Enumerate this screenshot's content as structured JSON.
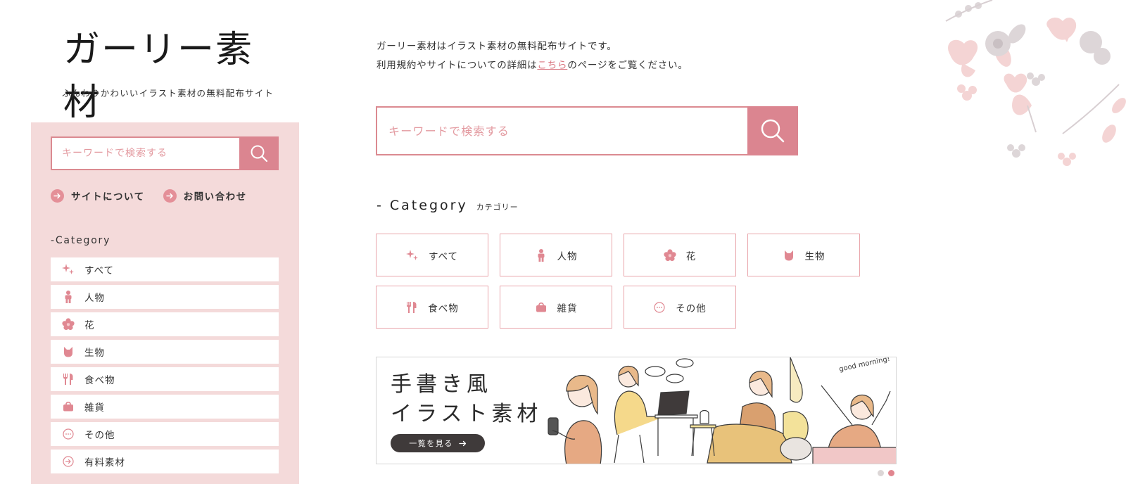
{
  "site": {
    "title": "ガーリー素材",
    "tagline": "ふんわりかわいいイラスト素材の無料配布サイト"
  },
  "intro": {
    "line1": "ガーリー素材はイラスト素材の無料配布サイトです。",
    "line2_before": "利用規約やサイトについての詳細は",
    "line2_link": "こちら",
    "line2_after": "のページをご覧ください。"
  },
  "search": {
    "placeholder": "キーワードで検索する"
  },
  "sidebar": {
    "links": [
      {
        "label": "サイトについて"
      },
      {
        "label": "お問い合わせ"
      }
    ],
    "category_heading": "-Category",
    "items": [
      {
        "label": "すべて",
        "icon": "sparkle-icon"
      },
      {
        "label": "人物",
        "icon": "person-icon"
      },
      {
        "label": "花",
        "icon": "flower-icon"
      },
      {
        "label": "生物",
        "icon": "cat-icon"
      },
      {
        "label": "食べ物",
        "icon": "fork-knife-icon"
      },
      {
        "label": "雑貨",
        "icon": "bag-icon"
      },
      {
        "label": "その他",
        "icon": "more-icon"
      },
      {
        "label": "有料素材",
        "icon": "arrow-circle-icon"
      }
    ]
  },
  "category": {
    "heading_en": "- Category",
    "heading_ja": "カテゴリー",
    "tiles": [
      {
        "label": "すべて",
        "icon": "sparkle-icon"
      },
      {
        "label": "人物",
        "icon": "person-icon"
      },
      {
        "label": "花",
        "icon": "flower-icon"
      },
      {
        "label": "生物",
        "icon": "cat-icon"
      },
      {
        "label": "食べ物",
        "icon": "fork-knife-icon"
      },
      {
        "label": "雑貨",
        "icon": "bag-icon"
      },
      {
        "label": "その他",
        "icon": "more-icon"
      }
    ]
  },
  "banner": {
    "title_line1": "手書き風",
    "title_line2": "イラスト素材",
    "button_label": "一覧を見る",
    "handwriting": "good morning!",
    "slides_total": 2,
    "slide_active": 2
  },
  "colors": {
    "accent": "#db8590",
    "sidebar_bg": "#f4dada",
    "tile_border": "#e9a5ab",
    "button_dark": "#3f3a3a"
  }
}
